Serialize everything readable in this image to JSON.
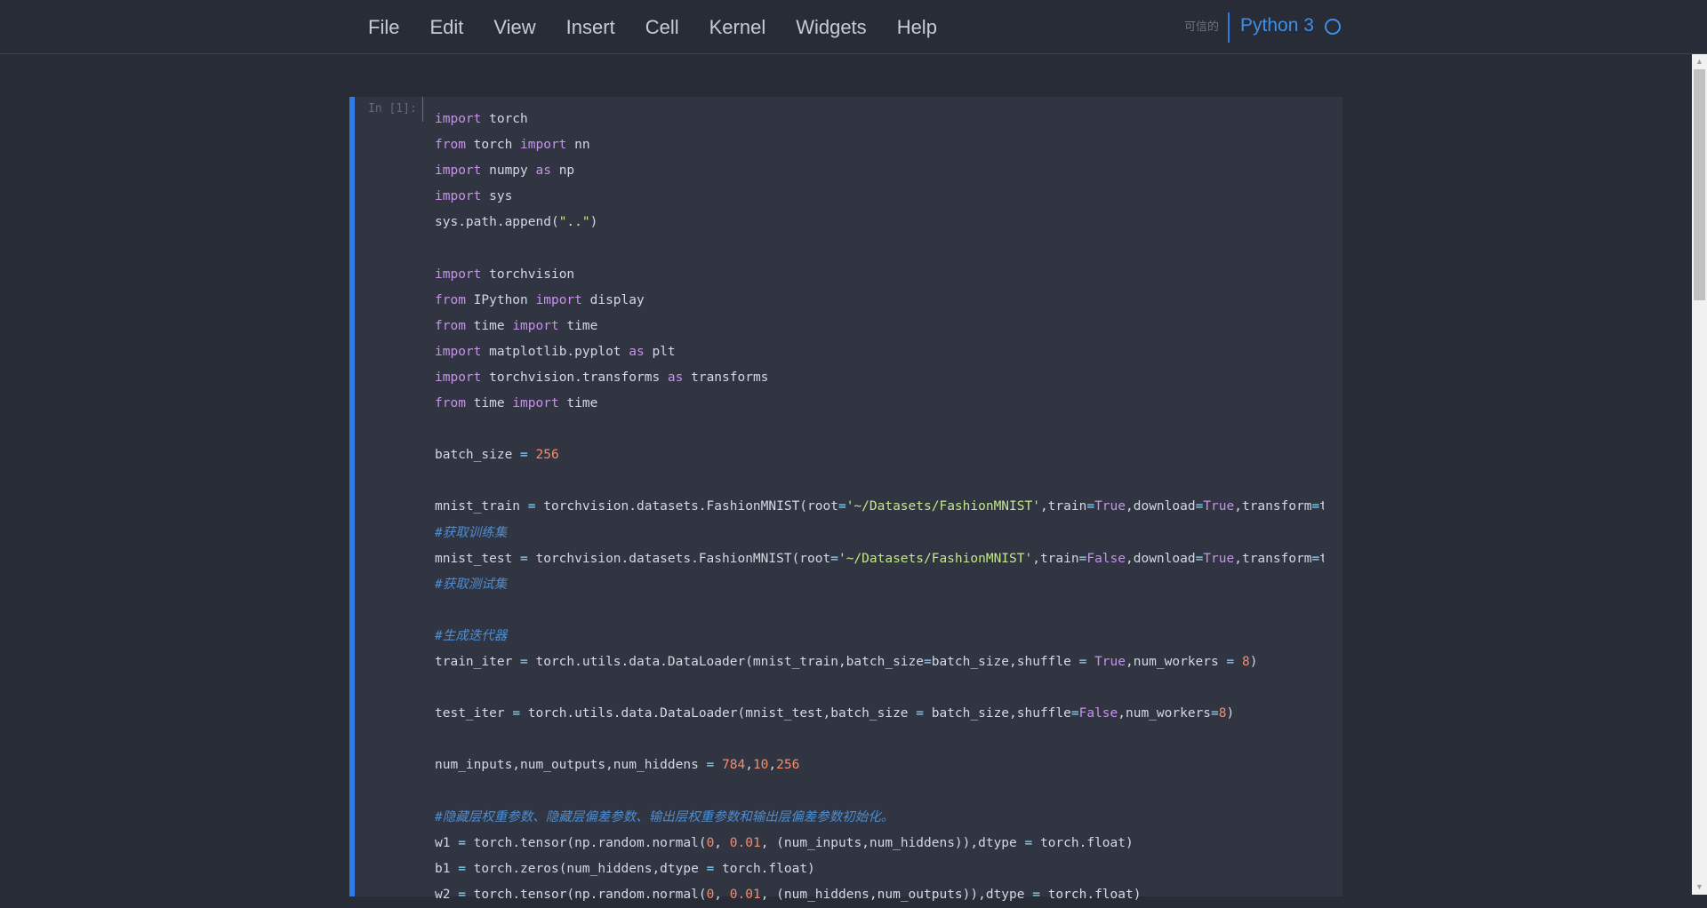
{
  "menu": {
    "items": [
      "File",
      "Edit",
      "View",
      "Insert",
      "Cell",
      "Kernel",
      "Widgets",
      "Help"
    ]
  },
  "kernel": {
    "trusted_label": "可信的",
    "name": "Python 3"
  },
  "cell": {
    "prompt": "In [1]:",
    "code_lines": [
      [
        [
          "kw",
          "import"
        ],
        [
          "t",
          " torch"
        ]
      ],
      [
        [
          "kw",
          "from"
        ],
        [
          "t",
          " torch "
        ],
        [
          "kw",
          "import"
        ],
        [
          "t",
          " nn"
        ]
      ],
      [
        [
          "kw",
          "import"
        ],
        [
          "t",
          " numpy "
        ],
        [
          "kw",
          "as"
        ],
        [
          "t",
          " np"
        ]
      ],
      [
        [
          "kw",
          "import"
        ],
        [
          "t",
          " sys"
        ]
      ],
      [
        [
          "t",
          "sys.path.append("
        ],
        [
          "str",
          "\"..\""
        ],
        [
          "t",
          ")"
        ]
      ],
      [],
      [
        [
          "kw",
          "import"
        ],
        [
          "t",
          " torchvision"
        ]
      ],
      [
        [
          "kw",
          "from"
        ],
        [
          "t",
          " IPython "
        ],
        [
          "kw",
          "import"
        ],
        [
          "t",
          " display"
        ]
      ],
      [
        [
          "kw",
          "from"
        ],
        [
          "t",
          " time "
        ],
        [
          "kw",
          "import"
        ],
        [
          "t",
          " time"
        ]
      ],
      [
        [
          "kw",
          "import"
        ],
        [
          "t",
          " matplotlib.pyplot "
        ],
        [
          "kw",
          "as"
        ],
        [
          "t",
          " plt"
        ]
      ],
      [
        [
          "kw",
          "import"
        ],
        [
          "t",
          " torchvision.transforms "
        ],
        [
          "kw",
          "as"
        ],
        [
          "t",
          " transforms"
        ]
      ],
      [
        [
          "kw",
          "from"
        ],
        [
          "t",
          " time "
        ],
        [
          "kw",
          "import"
        ],
        [
          "t",
          " time"
        ]
      ],
      [],
      [
        [
          "t",
          "batch_size "
        ],
        [
          "op",
          "="
        ],
        [
          "t",
          " "
        ],
        [
          "num",
          "256"
        ]
      ],
      [],
      [
        [
          "t",
          "mnist_train "
        ],
        [
          "op",
          "="
        ],
        [
          "t",
          " torchvision.datasets.FashionMNIST(root"
        ],
        [
          "op",
          "="
        ],
        [
          "str",
          "'~/Datasets/FashionMNIST'"
        ],
        [
          "t",
          ",train"
        ],
        [
          "op",
          "="
        ],
        [
          "bool",
          "True"
        ],
        [
          "t",
          ",download"
        ],
        [
          "op",
          "="
        ],
        [
          "bool",
          "True"
        ],
        [
          "t",
          ",transform"
        ],
        [
          "op",
          "="
        ],
        [
          "t",
          "transforms.ToTensor())"
        ]
      ],
      [
        [
          "comment",
          "#获取训练集"
        ]
      ],
      [
        [
          "t",
          "mnist_test "
        ],
        [
          "op",
          "="
        ],
        [
          "t",
          " torchvision.datasets.FashionMNIST(root"
        ],
        [
          "op",
          "="
        ],
        [
          "str",
          "'~/Datasets/FashionMNIST'"
        ],
        [
          "t",
          ",train"
        ],
        [
          "op",
          "="
        ],
        [
          "bool",
          "False"
        ],
        [
          "t",
          ",download"
        ],
        [
          "op",
          "="
        ],
        [
          "bool",
          "True"
        ],
        [
          "t",
          ",transform"
        ],
        [
          "op",
          "="
        ],
        [
          "t",
          "transforms.ToTensor())"
        ]
      ],
      [
        [
          "comment",
          "#获取测试集"
        ]
      ],
      [],
      [
        [
          "comment",
          "#生成迭代器"
        ]
      ],
      [
        [
          "t",
          "train_iter "
        ],
        [
          "op",
          "="
        ],
        [
          "t",
          " torch.utils.data.DataLoader(mnist_train,batch_size"
        ],
        [
          "op",
          "="
        ],
        [
          "t",
          "batch_size,shuffle "
        ],
        [
          "op",
          "="
        ],
        [
          "t",
          " "
        ],
        [
          "bool",
          "True"
        ],
        [
          "t",
          ",num_workers "
        ],
        [
          "op",
          "="
        ],
        [
          "t",
          " "
        ],
        [
          "num",
          "8"
        ],
        [
          "t",
          ")"
        ]
      ],
      [],
      [
        [
          "t",
          "test_iter "
        ],
        [
          "op",
          "="
        ],
        [
          "t",
          " torch.utils.data.DataLoader(mnist_test,batch_size "
        ],
        [
          "op",
          "="
        ],
        [
          "t",
          " batch_size,shuffle"
        ],
        [
          "op",
          "="
        ],
        [
          "bool",
          "False"
        ],
        [
          "t",
          ",num_workers"
        ],
        [
          "op",
          "="
        ],
        [
          "num",
          "8"
        ],
        [
          "t",
          ")"
        ]
      ],
      [],
      [
        [
          "t",
          "num_inputs,num_outputs,num_hiddens "
        ],
        [
          "op",
          "="
        ],
        [
          "t",
          " "
        ],
        [
          "num",
          "784"
        ],
        [
          "t",
          ","
        ],
        [
          "num",
          "10"
        ],
        [
          "t",
          ","
        ],
        [
          "num",
          "256"
        ]
      ],
      [],
      [
        [
          "comment",
          "#隐藏层权重参数、隐藏层偏差参数、输出层权重参数和输出层偏差参数初始化。"
        ]
      ],
      [
        [
          "t",
          "w1 "
        ],
        [
          "op",
          "="
        ],
        [
          "t",
          " torch.tensor(np.random.normal("
        ],
        [
          "num",
          "0"
        ],
        [
          "t",
          ", "
        ],
        [
          "num",
          "0.01"
        ],
        [
          "t",
          ", (num_inputs,num_hiddens)),dtype "
        ],
        [
          "op",
          "="
        ],
        [
          "t",
          " torch.float)"
        ]
      ],
      [
        [
          "t",
          "b1 "
        ],
        [
          "op",
          "="
        ],
        [
          "t",
          " torch.zeros(num_hiddens,dtype "
        ],
        [
          "op",
          "="
        ],
        [
          "t",
          " torch.float)"
        ]
      ],
      [
        [
          "t",
          "w2 "
        ],
        [
          "op",
          "="
        ],
        [
          "t",
          " torch.tensor(np.random.normal("
        ],
        [
          "num",
          "0"
        ],
        [
          "t",
          ", "
        ],
        [
          "num",
          "0.01"
        ],
        [
          "t",
          ", (num_hiddens,num_outputs)),dtype "
        ],
        [
          "op",
          "="
        ],
        [
          "t",
          " torch.float)"
        ]
      ]
    ]
  }
}
